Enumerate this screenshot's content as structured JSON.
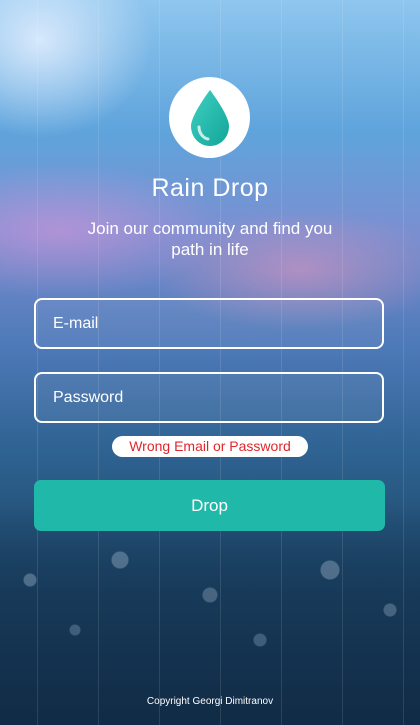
{
  "app": {
    "title": "Rain Drop",
    "tagline": "Join our community and find you path in life",
    "logo_icon": "water-drop-icon",
    "accent_color": "#20b8a8"
  },
  "form": {
    "email_placeholder": "E-mail",
    "password_placeholder": "Password",
    "error_message": "Wrong Email or Password",
    "submit_label": "Drop"
  },
  "footer": {
    "copyright": "Copyright Georgi Dimitranov"
  }
}
